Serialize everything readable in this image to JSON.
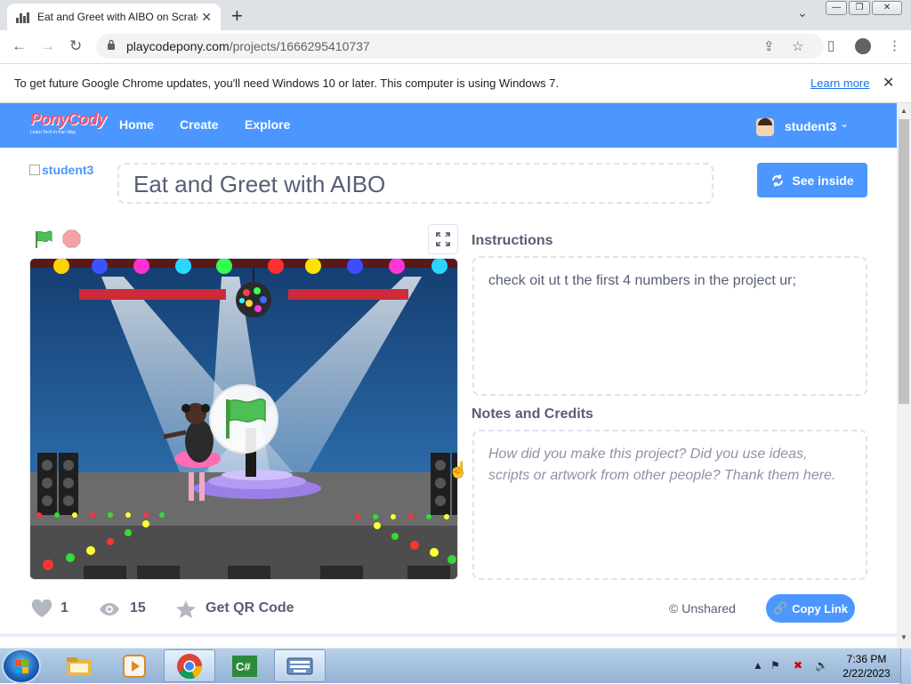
{
  "browser": {
    "tab_title": "Eat and Greet with AIBO on Scratch",
    "tab_close": "✕",
    "new_tab": "+",
    "url_host": "playcodepony.com",
    "url_path": "/projects/1666295410737",
    "window_controls": [
      "—",
      "❐",
      "✕"
    ]
  },
  "infobar": {
    "message": "To get future Google Chrome updates, you'll need Windows 10 or later. This computer is using Windows 7.",
    "link": "Learn more",
    "close": "✕"
  },
  "site": {
    "logo": "PonyCody",
    "logo_tagline": "Learn Tech in Fun Way",
    "nav": [
      "Home",
      "Create",
      "Explore"
    ],
    "user": "student3"
  },
  "project": {
    "author_alt": "student3",
    "title": "Eat and Greet with AIBO",
    "see_inside": "See inside",
    "instructions_label": "Instructions",
    "instructions": "check oit ut t the first 4 numbers in the project ur;",
    "notes_label": "Notes and Credits",
    "notes_placeholder": "How did you make this project? Did you use ideas, scripts or artwork from other people? Thank them here.",
    "loves": "1",
    "views": "15",
    "qr": "Get QR Code",
    "share_status": "Unshared",
    "copy_link": "Copy Link"
  },
  "taskbar": {
    "time": "7:36 PM",
    "date": "2/22/2023"
  },
  "colors": {
    "brand_blue": "#4c97ff",
    "text_gray": "#575e75",
    "stage_sky": "#1e4f8a"
  }
}
